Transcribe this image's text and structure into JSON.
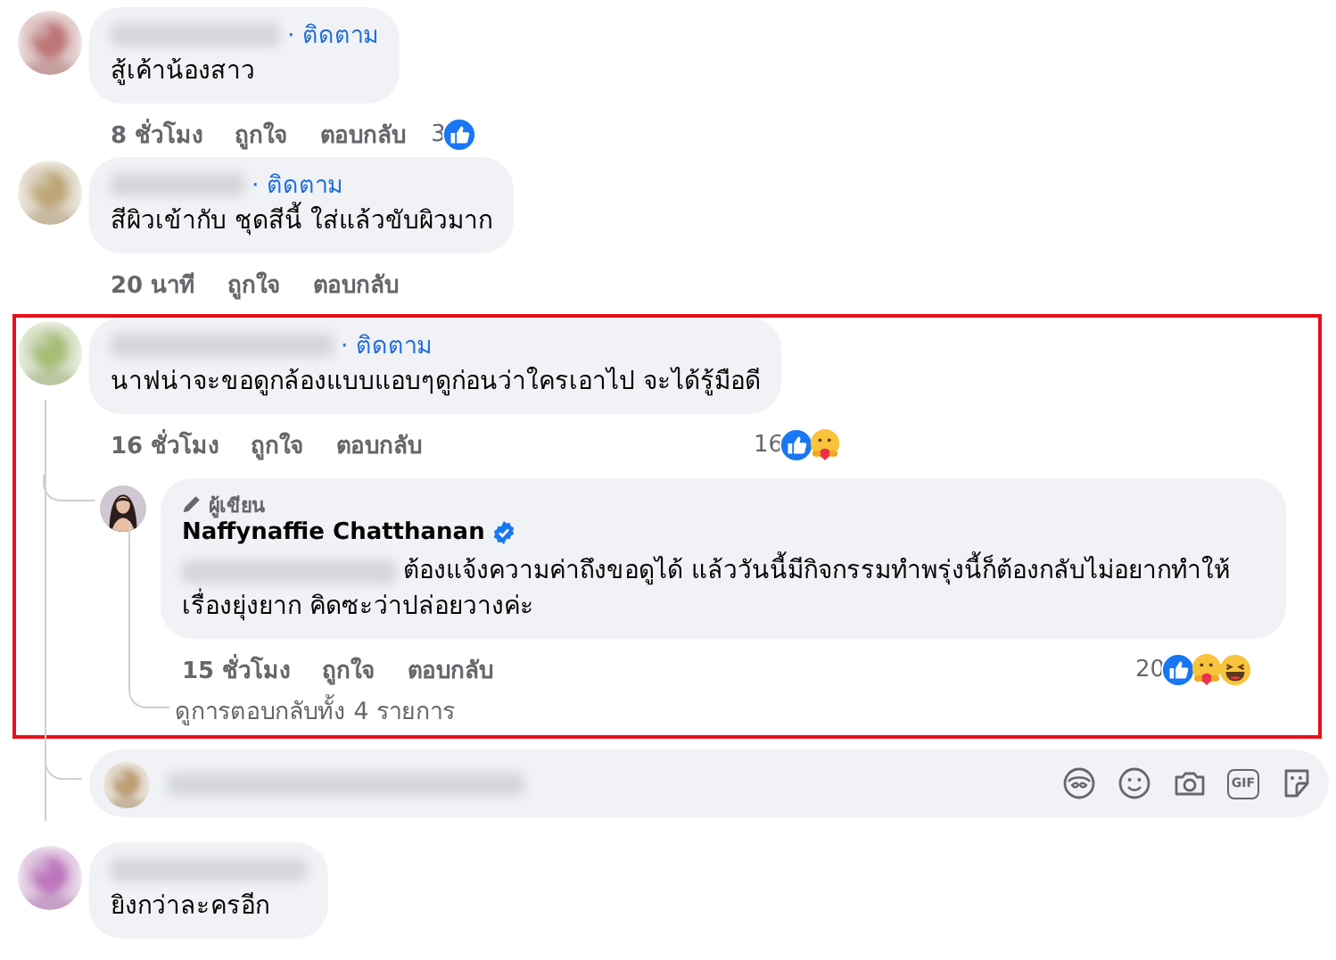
{
  "comments": [
    {
      "follow": "· ติดตาม",
      "text": "สู้เค้าน้องสาว",
      "time": "8 ชั่วโมง",
      "like": "ถูกใจ",
      "reply": "ตอบกลับ",
      "reaction_count": "3",
      "reactions": [
        {
          "kind": "like"
        }
      ],
      "highlighted": false
    },
    {
      "follow": "· ติดตาม",
      "text": "สีผิวเข้ากับ ชุดสีนี้ ใส่แล้วขับผิวมาก",
      "time": "20 นาที",
      "like": "ถูกใจ",
      "reply": "ตอบกลับ",
      "highlighted": false
    },
    {
      "follow": "· ติดตาม",
      "text": "นาฟน่าจะขอดูกล้องแบบแอบๆดูก่อนว่าใครเอาไป จะได้รู้มือดี",
      "time": "16 ชั่วโมง",
      "like": "ถูกใจ",
      "reply": "ตอบกลับ",
      "reaction_count": "16",
      "reactions": [
        {
          "kind": "like"
        },
        {
          "kind": "care"
        }
      ],
      "highlighted": true,
      "replies": [
        {
          "badge": "ผู้เขียน",
          "name": "Naffynaffie Chatthanan",
          "verified": true,
          "redacted_mention": true,
          "text": "ต้องแจ้งความค่าถึงขอดูได้ แล้ววันนี้มีกิจกรรมทำพรุ่งนี้ก็ต้องกลับไม่อยากทำให้เรื่องยุ่งยาก คิดซะว่าปล่อยวางค่ะ",
          "time": "15 ชั่วโมง",
          "like": "ถูกใจ",
          "reply": "ตอบกลับ",
          "reaction_count": "20",
          "reactions": [
            {
              "kind": "like"
            },
            {
              "kind": "care"
            },
            {
              "kind": "haha"
            }
          ]
        }
      ],
      "view_replies": "ดูการตอบกลับทั้ง 4 รายการ"
    }
  ],
  "composer": {
    "tools": [
      {
        "kind": "avatar"
      },
      {
        "kind": "emoji"
      },
      {
        "kind": "camera"
      },
      {
        "kind": "gif",
        "label": "GIF"
      },
      {
        "kind": "sticker"
      }
    ]
  },
  "last_comment": {
    "text": "ยิงกว่าละครอีก"
  }
}
